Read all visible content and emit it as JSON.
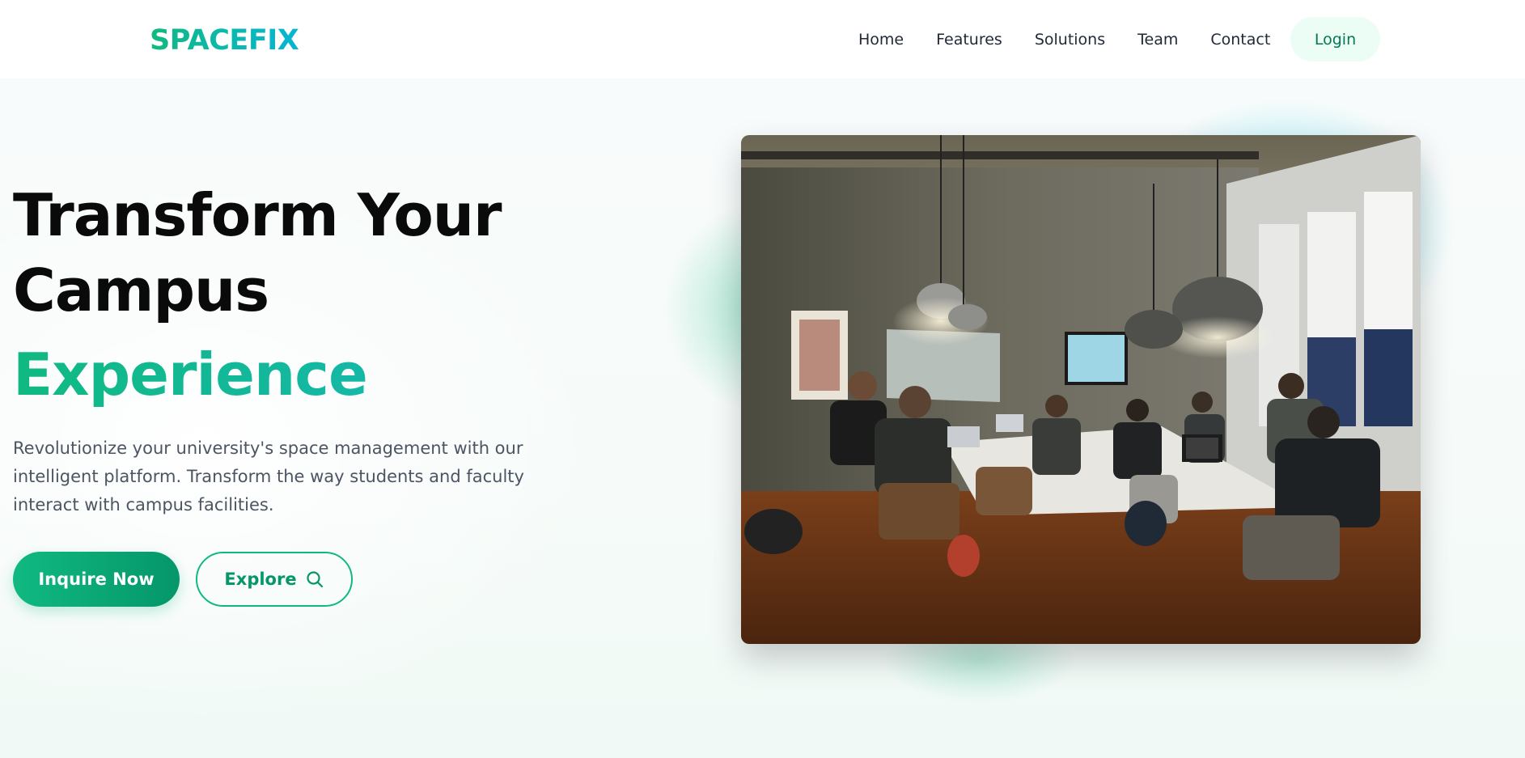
{
  "header": {
    "logo": "SPACEFIX",
    "nav": [
      "Home",
      "Features",
      "Solutions",
      "Team",
      "Contact"
    ],
    "login_label": "Login"
  },
  "hero": {
    "title_line1": "Transform Your",
    "title_line2": "Campus",
    "title_highlight": "Experience",
    "description": "Revolutionize your university's space management with our intelligent platform. Transform the way students and faculty interact with campus facilities.",
    "primary_button": "Inquire Now",
    "secondary_button": "Explore",
    "secondary_icon": "search-icon",
    "image_subject": "meeting-room-photo"
  },
  "colors": {
    "brand_green": "#10b981",
    "brand_cyan": "#06b6d4",
    "login_bg": "#ecfdf5",
    "text_dark": "#0a0a0a",
    "text_muted": "#4b5563"
  }
}
